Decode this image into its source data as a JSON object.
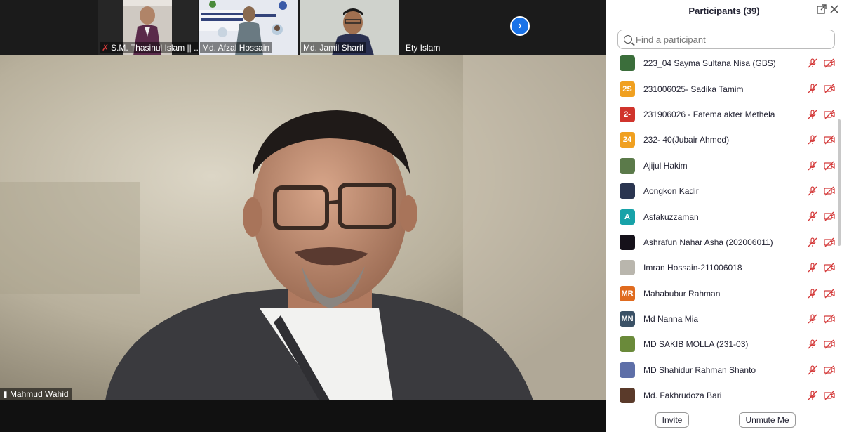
{
  "thumbnails": [
    {
      "name": "S.M. Thasinul Islam || ...",
      "muted": true
    },
    {
      "name": "Md. Afzal Hossain",
      "muted": false
    },
    {
      "name": "Md. Jamil Sharif",
      "muted": false
    },
    {
      "name": "Ety Islam",
      "muted": false
    }
  ],
  "main_video": {
    "speaker_name": "Mahmud Wahid"
  },
  "participants_panel": {
    "title": "Participants (39)",
    "search_placeholder": "Find a participant",
    "invite_label": "Invite",
    "unmute_label": "Unmute Me",
    "participants": [
      {
        "name": "223_04 Sayma Sultana Nisa (GBS)",
        "initials": "",
        "color": "#3b6e3b"
      },
      {
        "name": "231006025- Sadika Tamim",
        "initials": "2S",
        "color": "#f0a020"
      },
      {
        "name": "231906026 - Fatema akter Methela",
        "initials": "2-",
        "color": "#d0342c"
      },
      {
        "name": "232- 40(Jubair Ahmed)",
        "initials": "24",
        "color": "#f0a020"
      },
      {
        "name": "Ajijul Hakim",
        "initials": "",
        "color": "#5b7a4a"
      },
      {
        "name": "Aongkon Kadir",
        "initials": "",
        "color": "#2a3550"
      },
      {
        "name": "Asfakuzzaman",
        "initials": "A",
        "color": "#17a2a8"
      },
      {
        "name": "Ashrafun Nahar Asha (202006011)",
        "initials": "",
        "color": "#15111a"
      },
      {
        "name": "Imran Hossain-211006018",
        "initials": "",
        "color": "#b9b6ad"
      },
      {
        "name": "Mahabubur Rahman",
        "initials": "MR",
        "color": "#e06b1f"
      },
      {
        "name": "Md Nanna Mia",
        "initials": "MN",
        "color": "#3a5166"
      },
      {
        "name": "MD SAKIB MOLLA (231-03)",
        "initials": "",
        "color": "#6a8a3a"
      },
      {
        "name": "MD Shahidur Rahman Shanto",
        "initials": "",
        "color": "#5e6fa8"
      },
      {
        "name": "Md. Fakhrudoza Bari",
        "initials": "",
        "color": "#5a3a2a"
      }
    ]
  }
}
